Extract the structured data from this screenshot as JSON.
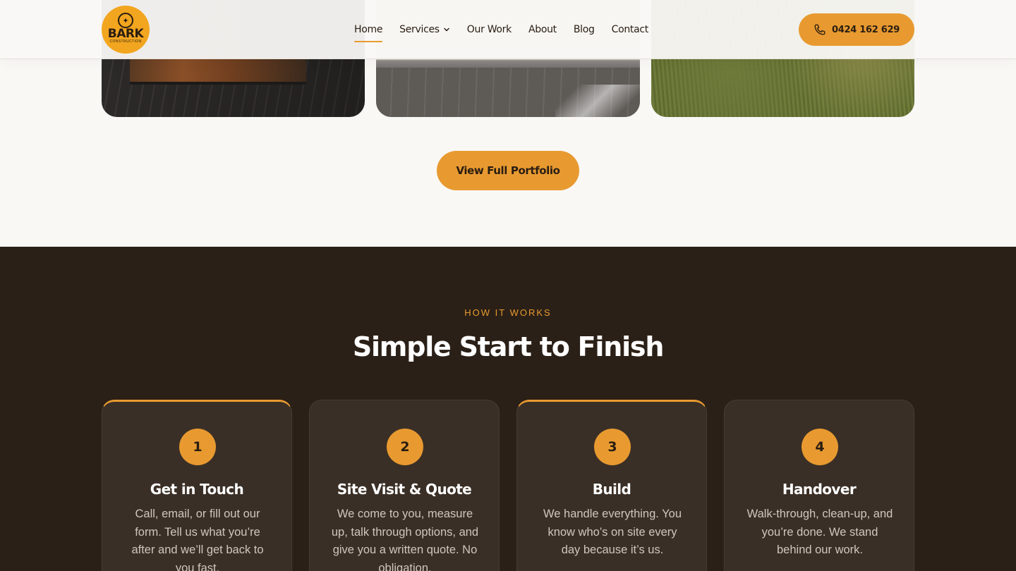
{
  "header": {
    "logo": {
      "word": "BARK",
      "sub": "CONSTRUCTION"
    },
    "nav": [
      {
        "label": "Home",
        "active": true
      },
      {
        "label": "Services",
        "dropdown": true
      },
      {
        "label": "Our Work"
      },
      {
        "label": "About"
      },
      {
        "label": "Blog"
      },
      {
        "label": "Contact"
      }
    ],
    "phone": "0424 162 629"
  },
  "portfolio": {
    "button_label": "View Full Portfolio"
  },
  "how_it_works": {
    "eyebrow": "HOW IT WORKS",
    "title": "Simple Start to Finish",
    "steps": [
      {
        "number": "1",
        "title": "Get in Touch",
        "description": "Call, email, or fill out our form. Tell us what you’re after and we’ll get back to you fast."
      },
      {
        "number": "2",
        "title": "Site Visit & Quote",
        "description": "We come to you, measure up, talk through options, and give you a written quote. No obligation."
      },
      {
        "number": "3",
        "title": "Build",
        "description": "We handle everything. You know who’s on site every day because it’s us."
      },
      {
        "number": "4",
        "title": "Handover",
        "description": "Walk-through, clean-up, and you’re done. We stand behind our work."
      }
    ]
  },
  "colors": {
    "accent": "#e89a30",
    "dark_bg": "#2b2017",
    "card_bg": "#3a2f26",
    "page_bg": "#f9f8f5"
  }
}
